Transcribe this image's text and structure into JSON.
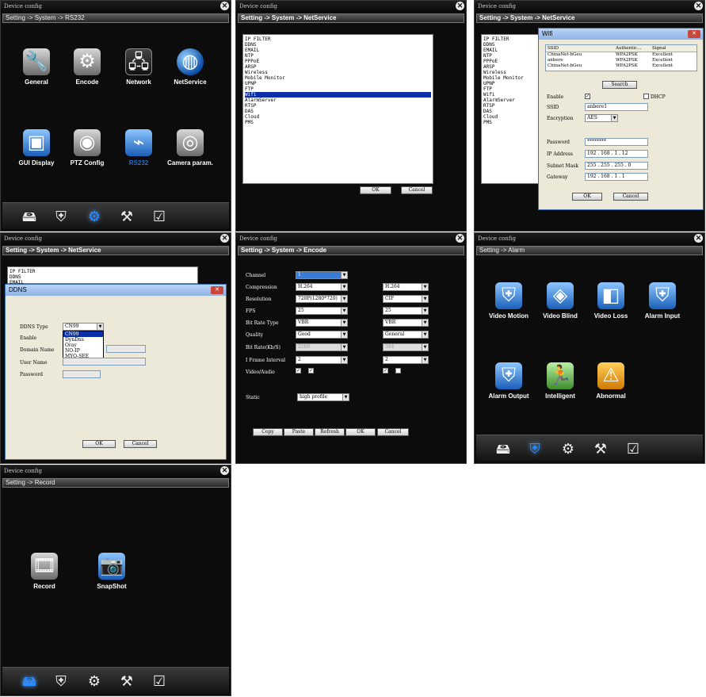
{
  "common": {
    "window_title": "Device config",
    "close_glyph": "✕",
    "ok": "OK",
    "cancel": "Cancel"
  },
  "rs232": {
    "breadcrumb": "Setting -> System -> RS232",
    "icons": [
      {
        "label": "General",
        "icon": "wrench-gear-icon"
      },
      {
        "label": "Encode",
        "icon": "gears-icon"
      },
      {
        "label": "Network",
        "icon": "network-icon"
      },
      {
        "label": "NetService",
        "icon": "globe-icon"
      },
      {
        "label": "GUI Display",
        "icon": "gui-display-icon"
      },
      {
        "label": "PTZ Config",
        "icon": "ptz-camera-icon"
      },
      {
        "label": "RS232",
        "icon": "rs232-cable-icon"
      },
      {
        "label": "Camera param.",
        "icon": "camera-gear-icon"
      }
    ],
    "active_label_color": "#1e6ed8"
  },
  "netservice": {
    "breadcrumb": "Setting -> System -> NetService",
    "items": [
      "IP FILTER",
      "DDNS",
      "EMAIL",
      "NTP",
      "PPPoE",
      "ARSP",
      "Wireless",
      "Mobile Monitor",
      "UPNP",
      "FTP",
      "Wifi",
      "AlarmServer",
      "RTSP",
      "DAS",
      "Cloud",
      "PMS"
    ],
    "selected_item": "Wifi",
    "selected_color": "#0a2fa8"
  },
  "wifi": {
    "breadcrumb": "Setting -> System -> NetService",
    "items": [
      "IP FILTER",
      "DDNS",
      "EMAIL",
      "NTP",
      "PPPoE",
      "ARSP",
      "Wireless",
      "Mobile Monitor",
      "UPNP",
      "FTP",
      "Wifi",
      "AlarmServer",
      "RTSP",
      "DAS",
      "Cloud",
      "PMS"
    ],
    "dialog_title": "Wifi",
    "columns": [
      "SSID",
      "Authentic...",
      "Signal"
    ],
    "networks": [
      {
        "ssid": "ChinaNet-bGeu",
        "auth": "WPA2PSK",
        "signal": "Excellent"
      },
      {
        "ssid": "anbere",
        "auth": "WPA2PSK",
        "signal": "Excellent"
      },
      {
        "ssid": "ChinaNet-bGeu",
        "auth": "WPA2PSK",
        "signal": "Excellent"
      }
    ],
    "search": "Search",
    "enable_label": "Enable",
    "enable_checked": "✓",
    "dhcp_label": "DHCP",
    "ssid_label": "SSID",
    "ssid_value": "anbere1",
    "encryption_label": "Encryption",
    "encryption_value": "AES",
    "password_label": "Password",
    "password_value": "********",
    "ip_label": "IP Address",
    "ip_value": "192 . 168 .  1  . 12",
    "mask_label": "Subnet Mask",
    "mask_value": "255 . 255 . 255 .  0",
    "gateway_label": "Gateway",
    "gateway_value": "192 . 168 .  1  .  1"
  },
  "ddns": {
    "items": [
      "IP FILTER",
      "DDNS",
      "EMAIL"
    ],
    "dialog_title": "DDNS",
    "type_label": "DDNS Type",
    "type_value": "CN99",
    "options": [
      "CN99",
      "DynDns",
      "Oray",
      "NO-IP",
      "MYQ-SEE"
    ],
    "enable_label": "Enable",
    "domain_label": "Domain Name",
    "user_label": "User Name",
    "password_label": "Password"
  },
  "encode": {
    "breadcrumb": "Setting -> System -> Encode",
    "labels": [
      "Channel",
      "Compression",
      "Resolution",
      "FPS",
      "Bit Rate Type",
      "Quality",
      "Bit Rate(Kb/S)",
      "I Frame Interval",
      "Video/Audio"
    ],
    "main": [
      "1",
      "H.264",
      "720P(1280*720)",
      "25",
      "VBR",
      "Good",
      "2560",
      "2"
    ],
    "extra": [
      "H.264",
      "CIF",
      "25",
      "VBR",
      "General",
      "384",
      "2"
    ],
    "static_label": "Static",
    "static_value": "high profile",
    "check_mark": "✓",
    "buttons": [
      "Copy",
      "Paste",
      "Refresh",
      "OK",
      "Cancel"
    ]
  },
  "alarm": {
    "breadcrumb": "Setting -> Alarm",
    "icons": [
      {
        "label": "Video Motion",
        "icon": "video-motion-icon"
      },
      {
        "label": "Video Blind",
        "icon": "video-blind-icon"
      },
      {
        "label": "Video Loss",
        "icon": "video-loss-icon"
      },
      {
        "label": "Alarm Input",
        "icon": "alarm-input-icon"
      },
      {
        "label": "Alarm Output",
        "icon": "alarm-output-icon"
      },
      {
        "label": "Intelligent",
        "icon": "intelligent-icon"
      },
      {
        "label": "Abnormal",
        "icon": "abnormal-icon"
      }
    ]
  },
  "record": {
    "breadcrumb": "Setting -> Record",
    "icons": [
      {
        "label": "Record",
        "icon": "film-reel-icon"
      },
      {
        "label": "SnapShot",
        "icon": "snapshot-camera-icon"
      }
    ]
  },
  "taskbar": [
    "hdd-icon",
    "shield-icon",
    "gear-icon",
    "tools-icon",
    "checklist-icon"
  ]
}
